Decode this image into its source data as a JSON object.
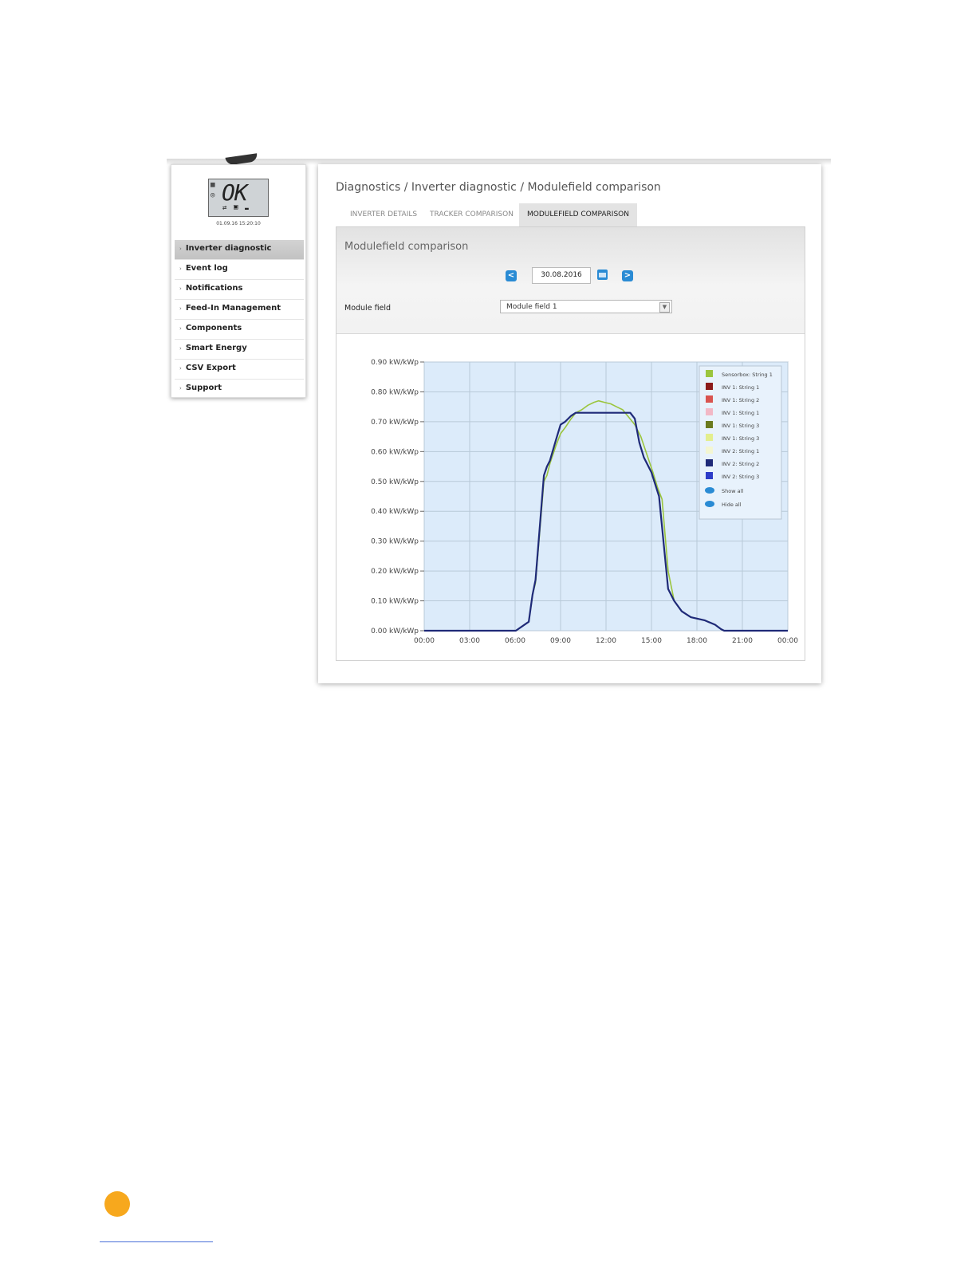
{
  "status": {
    "display": "OK",
    "timestamp": "01.09.16 15:20:10"
  },
  "sidebar": {
    "items": [
      {
        "label": "Inverter diagnostic"
      },
      {
        "label": "Event log"
      },
      {
        "label": "Notifications"
      },
      {
        "label": "Feed-In Management"
      },
      {
        "label": "Components"
      },
      {
        "label": "Smart Energy"
      },
      {
        "label": "CSV Export"
      },
      {
        "label": "Support"
      }
    ]
  },
  "main": {
    "breadcrumb": "Diagnostics / Inverter diagnostic / Modulefield comparison",
    "tabs": [
      {
        "label": "INVERTER DETAILS"
      },
      {
        "label": "TRACKER COMPARISON"
      },
      {
        "label": "MODULEFIELD COMPARISON"
      }
    ],
    "section_title": "Modulefield comparison",
    "date_value": "30.08.2016",
    "prev_label": "<",
    "next_label": ">",
    "module_field_label": "Module field",
    "module_field_value": "Module field 1"
  },
  "colors": {
    "accent": "#2a8bd4",
    "plot_background": "#dcebfa",
    "orange_dot": "#f7a81d"
  },
  "chart_data": {
    "type": "line",
    "title": "",
    "xlabel": "",
    "ylabel": "",
    "x_ticks": [
      "00:00",
      "03:00",
      "06:00",
      "09:00",
      "12:00",
      "15:00",
      "18:00",
      "21:00",
      "00:00"
    ],
    "y_ticks": [
      "0.00 kW/kWp",
      "0.10 kW/kWp",
      "0.20 kW/kWp",
      "0.30 kW/kWp",
      "0.40 kW/kWp",
      "0.50 kW/kWp",
      "0.60 kW/kWp",
      "0.70 kW/kWp",
      "0.80 kW/kWp",
      "0.90 kW/kWp"
    ],
    "xlim": [
      0,
      24
    ],
    "ylim": [
      0,
      0.9
    ],
    "grid": true,
    "legend_position": "top-right",
    "legend": [
      {
        "name": "Sensorbox: String 1",
        "color": "#9bc53d"
      },
      {
        "name": "INV 1: String 1",
        "color": "#8b1a1a"
      },
      {
        "name": "INV 1: String 2",
        "color": "#d9534f"
      },
      {
        "name": "INV 1: String 1",
        "color": "#f2b8c6"
      },
      {
        "name": "INV 1: String 3",
        "color": "#6b7a1e"
      },
      {
        "name": "INV 1: String 3",
        "color": "#e3ee8e"
      },
      {
        "name": "INV 2: String 1",
        "color": "#f3f6d2"
      },
      {
        "name": "INV 2: String 2",
        "color": "#1f2a78"
      },
      {
        "name": "INV 2: String 3",
        "color": "#2d3cc8"
      }
    ],
    "legend_actions": [
      "Show all",
      "Hide all"
    ],
    "series": [
      {
        "color": "#9bc53d",
        "points": [
          [
            0,
            0
          ],
          [
            6.05,
            0
          ],
          [
            6.9,
            0.03
          ],
          [
            7.15,
            0.12
          ],
          [
            7.35,
            0.16
          ],
          [
            7.9,
            0.5
          ],
          [
            8.1,
            0.52
          ],
          [
            8.3,
            0.56
          ],
          [
            8.7,
            0.62
          ],
          [
            9,
            0.66
          ],
          [
            9.3,
            0.68
          ],
          [
            9.7,
            0.71
          ],
          [
            10,
            0.73
          ],
          [
            10.4,
            0.74
          ],
          [
            10.8,
            0.755
          ],
          [
            11.2,
            0.765
          ],
          [
            11.5,
            0.77
          ],
          [
            11.9,
            0.765
          ],
          [
            12.3,
            0.76
          ],
          [
            12.7,
            0.75
          ],
          [
            13.1,
            0.74
          ],
          [
            13.5,
            0.715
          ],
          [
            13.9,
            0.69
          ],
          [
            14.3,
            0.65
          ],
          [
            14.7,
            0.59
          ],
          [
            15.1,
            0.53
          ],
          [
            15.4,
            0.48
          ],
          [
            15.7,
            0.44
          ],
          [
            16.1,
            0.2
          ],
          [
            16.5,
            0.1
          ],
          [
            17,
            0.065
          ],
          [
            17.6,
            0.045
          ],
          [
            18.5,
            0.035
          ],
          [
            19.2,
            0.02
          ],
          [
            19.6,
            0.005
          ],
          [
            19.8,
            0
          ],
          [
            24,
            0
          ]
        ]
      },
      {
        "color": "#1f2a78",
        "points": [
          [
            0,
            0
          ],
          [
            6.05,
            0
          ],
          [
            6.9,
            0.03
          ],
          [
            7.15,
            0.12
          ],
          [
            7.35,
            0.17
          ],
          [
            7.9,
            0.52
          ],
          [
            8.1,
            0.55
          ],
          [
            8.3,
            0.57
          ],
          [
            8.7,
            0.64
          ],
          [
            9,
            0.69
          ],
          [
            9.3,
            0.7
          ],
          [
            9.7,
            0.72
          ],
          [
            10,
            0.73
          ],
          [
            11,
            0.73
          ],
          [
            12,
            0.73
          ],
          [
            13,
            0.73
          ],
          [
            13.6,
            0.73
          ],
          [
            13.9,
            0.71
          ],
          [
            14.2,
            0.63
          ],
          [
            14.5,
            0.58
          ],
          [
            15,
            0.53
          ],
          [
            15.5,
            0.45
          ],
          [
            16.1,
            0.14
          ],
          [
            16.5,
            0.1
          ],
          [
            17,
            0.065
          ],
          [
            17.6,
            0.045
          ],
          [
            18.5,
            0.035
          ],
          [
            19.2,
            0.02
          ],
          [
            19.6,
            0.005
          ],
          [
            19.8,
            0
          ],
          [
            24,
            0
          ]
        ]
      }
    ]
  }
}
